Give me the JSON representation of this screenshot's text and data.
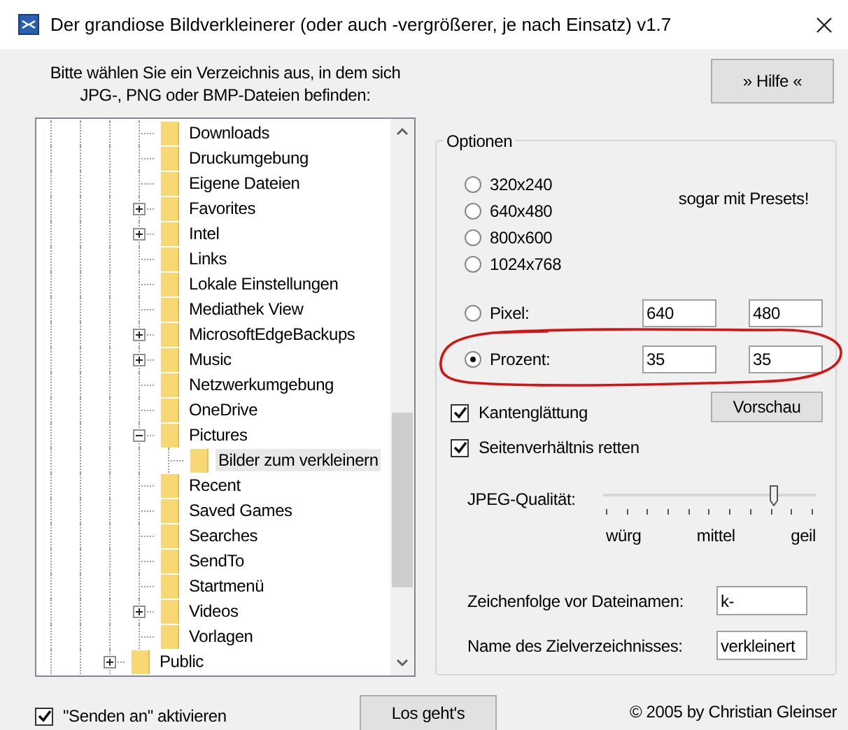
{
  "window": {
    "title": "Der grandiose Bildverkleinerer (oder auch -vergrößerer, je nach Einsatz) v1.7"
  },
  "instructions": "Bitte wählen Sie ein Verzeichnis aus, in dem sich JPG-, PNG oder BMP-Dateien befinden:",
  "help_button": "» Hilfe «",
  "tree": {
    "items": [
      {
        "children": [
          {
            "label": "Downloads",
            "selected": false
          },
          {
            "label": "Druckumgebung",
            "selected": false
          },
          {
            "label": "Eigene Dateien",
            "selected": false
          },
          {
            "label": "Favorites",
            "selected": false,
            "expanded": false
          },
          {
            "label": "Intel",
            "selected": false,
            "expanded": false
          },
          {
            "label": "Links",
            "selected": false
          },
          {
            "label": "Lokale Einstellungen",
            "selected": false
          },
          {
            "label": "Mediathek View",
            "selected": false
          },
          {
            "label": "MicrosoftEdgeBackups",
            "selected": false,
            "expanded": false
          },
          {
            "label": "Music",
            "selected": false,
            "expanded": false
          },
          {
            "label": "Netzwerkumgebung",
            "selected": false
          },
          {
            "label": "OneDrive",
            "selected": false
          },
          {
            "label": "Pictures",
            "selected": false,
            "expanded": true,
            "children": [
              {
                "label": "Bilder zum verkleinern",
                "selected": true
              }
            ]
          },
          {
            "label": "Recent",
            "selected": false
          },
          {
            "label": "Saved Games",
            "selected": false
          },
          {
            "label": "Searches",
            "selected": false
          },
          {
            "label": "SendTo",
            "selected": false
          },
          {
            "label": "Startmenü",
            "selected": false
          },
          {
            "label": "Videos",
            "selected": false,
            "expanded": false
          },
          {
            "label": "Vorlagen",
            "selected": false
          }
        ]
      },
      {
        "label": "Public",
        "selected": false,
        "expanded": false
      }
    ]
  },
  "options": {
    "title": "Optionen",
    "size_options": [
      {
        "kind": "preset",
        "label": "320x240",
        "selected": false,
        "circled": false
      },
      {
        "kind": "preset",
        "label": "640x480",
        "selected": false,
        "circled": false
      },
      {
        "kind": "preset",
        "label": "800x600",
        "selected": false,
        "circled": false
      },
      {
        "kind": "preset",
        "label": "1024x768",
        "selected": false,
        "circled": false
      },
      {
        "kind": "custom",
        "label": "Pixel:",
        "selected": false,
        "circled": false,
        "values": [
          "640",
          "480"
        ]
      },
      {
        "kind": "custom",
        "label": "Prozent:",
        "selected": true,
        "circled": true,
        "values": [
          "35",
          "35"
        ]
      }
    ],
    "presets_note": "sogar mit Presets!",
    "checkboxes": [
      {
        "label": "Kantenglättung",
        "checked": true
      },
      {
        "label": "Seitenverhältnis retten",
        "checked": true
      }
    ],
    "preview_button": "Vorschau",
    "quality": {
      "label": "JPEG-Qualität:",
      "level": 0.8,
      "scale_labels": [
        "würg",
        "mittel",
        "geil"
      ]
    },
    "text_fields": [
      {
        "label": "Zeichenfolge vor Dateinamen:",
        "value": "k-"
      },
      {
        "label": "Name des Zielverzeichnisses:",
        "value": "verkleinert"
      }
    ]
  },
  "send_to": {
    "label": "\"Senden an\" aktivieren",
    "checked": true
  },
  "start_button": "Los geht's",
  "copyright": "© 2005 by Christian Gleinser"
}
